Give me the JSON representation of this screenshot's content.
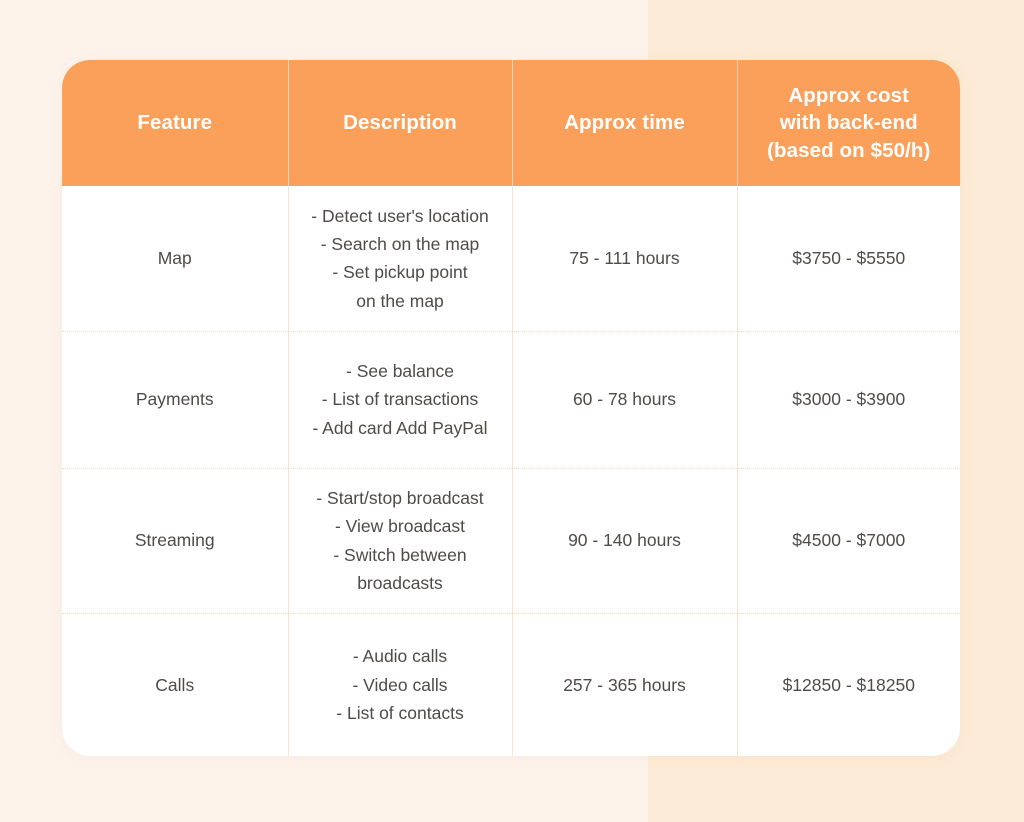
{
  "theme": {
    "header_bg": "#FBA05A",
    "header_text": "#FFFFFF",
    "card_bg": "#FFFFFF",
    "body_text": "#4F4B49",
    "divider": "#FAE2CC",
    "background_left": "#FDF3EB",
    "background_right": "#FCEBD6"
  },
  "table": {
    "headers": [
      {
        "label": "Feature"
      },
      {
        "label": "Description"
      },
      {
        "label": "Approx cost with back-end (based on $50/h)"
      }
    ],
    "header_feature": "Feature",
    "header_description": "Description",
    "header_time": "Approx time",
    "header_cost_line1": "Approx cost",
    "header_cost_line2": "with back-end",
    "header_cost_line3": "(based on $50/h)",
    "rows": [
      {
        "feature": "Map",
        "description_lines": [
          "- Detect user's location",
          "- Search on the map",
          "- Set pickup point",
          "on the map"
        ],
        "time": "75 - 111 hours",
        "cost": "$3750 - $5550"
      },
      {
        "feature": "Payments",
        "description_lines": [
          "- See balance",
          "- List of transactions",
          "- Add card Add PayPal"
        ],
        "time": "60 - 78 hours",
        "cost": "$3000 - $3900"
      },
      {
        "feature": "Streaming",
        "description_lines": [
          "- Start/stop broadcast",
          "- View broadcast",
          "- Switch between",
          "broadcasts"
        ],
        "time": "90 - 140 hours",
        "cost": "$4500 - $7000"
      },
      {
        "feature": "Calls",
        "description_lines": [
          "- Audio calls",
          "- Video calls",
          "- List of contacts"
        ],
        "time": "257 - 365 hours",
        "cost": "$12850 - $18250"
      }
    ]
  }
}
